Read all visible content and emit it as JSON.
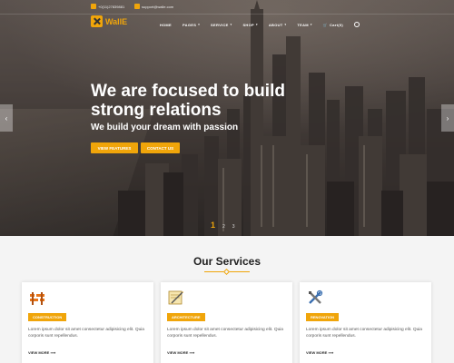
{
  "topbar": {
    "phone": "+0(11)27839881",
    "email": "support@walle.com",
    "cart": "Cart(0)"
  },
  "brand": {
    "name": "WallE"
  },
  "nav": {
    "items": [
      {
        "label": "HOME"
      },
      {
        "label": "PAGES",
        "dropdown": true
      },
      {
        "label": "SERVICE",
        "dropdown": true
      },
      {
        "label": "SHOP",
        "dropdown": true
      },
      {
        "label": "ABOUT",
        "dropdown": true
      },
      {
        "label": "TEAM",
        "dropdown": true
      }
    ],
    "cart_label": "Cart(0)"
  },
  "hero": {
    "headline_line1": "We are focused to build",
    "headline_line2": "strong relations",
    "subline": "We build your dream with passion",
    "btn_features": "VIEW FEATURES",
    "btn_contact": "CONTACT US",
    "arrow_prev": "‹",
    "arrow_next": "›",
    "pager": [
      "1",
      "2",
      "3"
    ],
    "active_slide": 1
  },
  "services": {
    "title": "Our Services",
    "cards": [
      {
        "icon": "barrier-icon",
        "tag": "CONSTRUCTION",
        "desc": "Lorem ipsum dolor sit amet consectetur adipisicing elit. Quia corporis sunt repellendus.",
        "more": "VIEW MORE ⟹"
      },
      {
        "icon": "blueprint-icon",
        "tag": "ARCHITECTURE",
        "desc": "Lorem ipsum dolor sit amet consectetur adipisicing elit. Quia corporis sunt repellendus.",
        "more": "VIEW MORE ⟹"
      },
      {
        "icon": "tools-icon",
        "tag": "RENOVATION",
        "desc": "Lorem ipsum dolor sit amet consectetur adipisicing elit. Quia corporis sunt repellendus.",
        "more": "VIEW MORE ⟹"
      }
    ]
  },
  "colors": {
    "accent": "#f0a50a",
    "text_dark": "#222222",
    "background": "#f4f4f4"
  }
}
